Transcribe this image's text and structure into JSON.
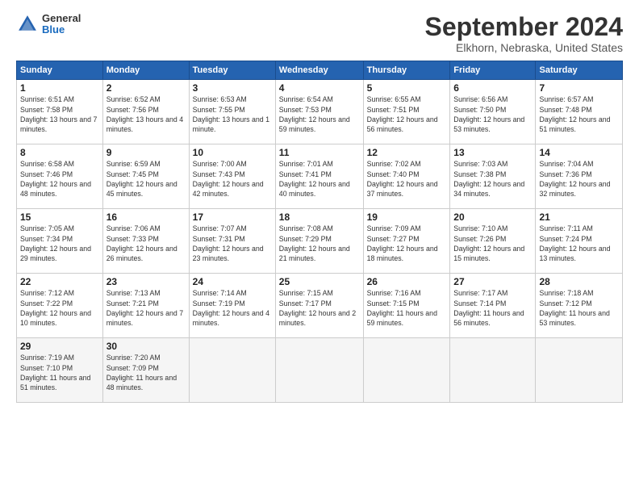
{
  "logo": {
    "general": "General",
    "blue": "Blue"
  },
  "title": "September 2024",
  "subtitle": "Elkhorn, Nebraska, United States",
  "days_of_week": [
    "Sunday",
    "Monday",
    "Tuesday",
    "Wednesday",
    "Thursday",
    "Friday",
    "Saturday"
  ],
  "weeks": [
    [
      {
        "day": "1",
        "rise": "6:51 AM",
        "set": "7:58 PM",
        "daylight": "13 hours and 7 minutes."
      },
      {
        "day": "2",
        "rise": "6:52 AM",
        "set": "7:56 PM",
        "daylight": "13 hours and 4 minutes."
      },
      {
        "day": "3",
        "rise": "6:53 AM",
        "set": "7:55 PM",
        "daylight": "13 hours and 1 minute."
      },
      {
        "day": "4",
        "rise": "6:54 AM",
        "set": "7:53 PM",
        "daylight": "12 hours and 59 minutes."
      },
      {
        "day": "5",
        "rise": "6:55 AM",
        "set": "7:51 PM",
        "daylight": "12 hours and 56 minutes."
      },
      {
        "day": "6",
        "rise": "6:56 AM",
        "set": "7:50 PM",
        "daylight": "12 hours and 53 minutes."
      },
      {
        "day": "7",
        "rise": "6:57 AM",
        "set": "7:48 PM",
        "daylight": "12 hours and 51 minutes."
      }
    ],
    [
      {
        "day": "8",
        "rise": "6:58 AM",
        "set": "7:46 PM",
        "daylight": "12 hours and 48 minutes."
      },
      {
        "day": "9",
        "rise": "6:59 AM",
        "set": "7:45 PM",
        "daylight": "12 hours and 45 minutes."
      },
      {
        "day": "10",
        "rise": "7:00 AM",
        "set": "7:43 PM",
        "daylight": "12 hours and 42 minutes."
      },
      {
        "day": "11",
        "rise": "7:01 AM",
        "set": "7:41 PM",
        "daylight": "12 hours and 40 minutes."
      },
      {
        "day": "12",
        "rise": "7:02 AM",
        "set": "7:40 PM",
        "daylight": "12 hours and 37 minutes."
      },
      {
        "day": "13",
        "rise": "7:03 AM",
        "set": "7:38 PM",
        "daylight": "12 hours and 34 minutes."
      },
      {
        "day": "14",
        "rise": "7:04 AM",
        "set": "7:36 PM",
        "daylight": "12 hours and 32 minutes."
      }
    ],
    [
      {
        "day": "15",
        "rise": "7:05 AM",
        "set": "7:34 PM",
        "daylight": "12 hours and 29 minutes."
      },
      {
        "day": "16",
        "rise": "7:06 AM",
        "set": "7:33 PM",
        "daylight": "12 hours and 26 minutes."
      },
      {
        "day": "17",
        "rise": "7:07 AM",
        "set": "7:31 PM",
        "daylight": "12 hours and 23 minutes."
      },
      {
        "day": "18",
        "rise": "7:08 AM",
        "set": "7:29 PM",
        "daylight": "12 hours and 21 minutes."
      },
      {
        "day": "19",
        "rise": "7:09 AM",
        "set": "7:27 PM",
        "daylight": "12 hours and 18 minutes."
      },
      {
        "day": "20",
        "rise": "7:10 AM",
        "set": "7:26 PM",
        "daylight": "12 hours and 15 minutes."
      },
      {
        "day": "21",
        "rise": "7:11 AM",
        "set": "7:24 PM",
        "daylight": "12 hours and 13 minutes."
      }
    ],
    [
      {
        "day": "22",
        "rise": "7:12 AM",
        "set": "7:22 PM",
        "daylight": "12 hours and 10 minutes."
      },
      {
        "day": "23",
        "rise": "7:13 AM",
        "set": "7:21 PM",
        "daylight": "12 hours and 7 minutes."
      },
      {
        "day": "24",
        "rise": "7:14 AM",
        "set": "7:19 PM",
        "daylight": "12 hours and 4 minutes."
      },
      {
        "day": "25",
        "rise": "7:15 AM",
        "set": "7:17 PM",
        "daylight": "12 hours and 2 minutes."
      },
      {
        "day": "26",
        "rise": "7:16 AM",
        "set": "7:15 PM",
        "daylight": "11 hours and 59 minutes."
      },
      {
        "day": "27",
        "rise": "7:17 AM",
        "set": "7:14 PM",
        "daylight": "11 hours and 56 minutes."
      },
      {
        "day": "28",
        "rise": "7:18 AM",
        "set": "7:12 PM",
        "daylight": "11 hours and 53 minutes."
      }
    ],
    [
      {
        "day": "29",
        "rise": "7:19 AM",
        "set": "7:10 PM",
        "daylight": "11 hours and 51 minutes."
      },
      {
        "day": "30",
        "rise": "7:20 AM",
        "set": "7:09 PM",
        "daylight": "11 hours and 48 minutes."
      },
      null,
      null,
      null,
      null,
      null
    ]
  ]
}
